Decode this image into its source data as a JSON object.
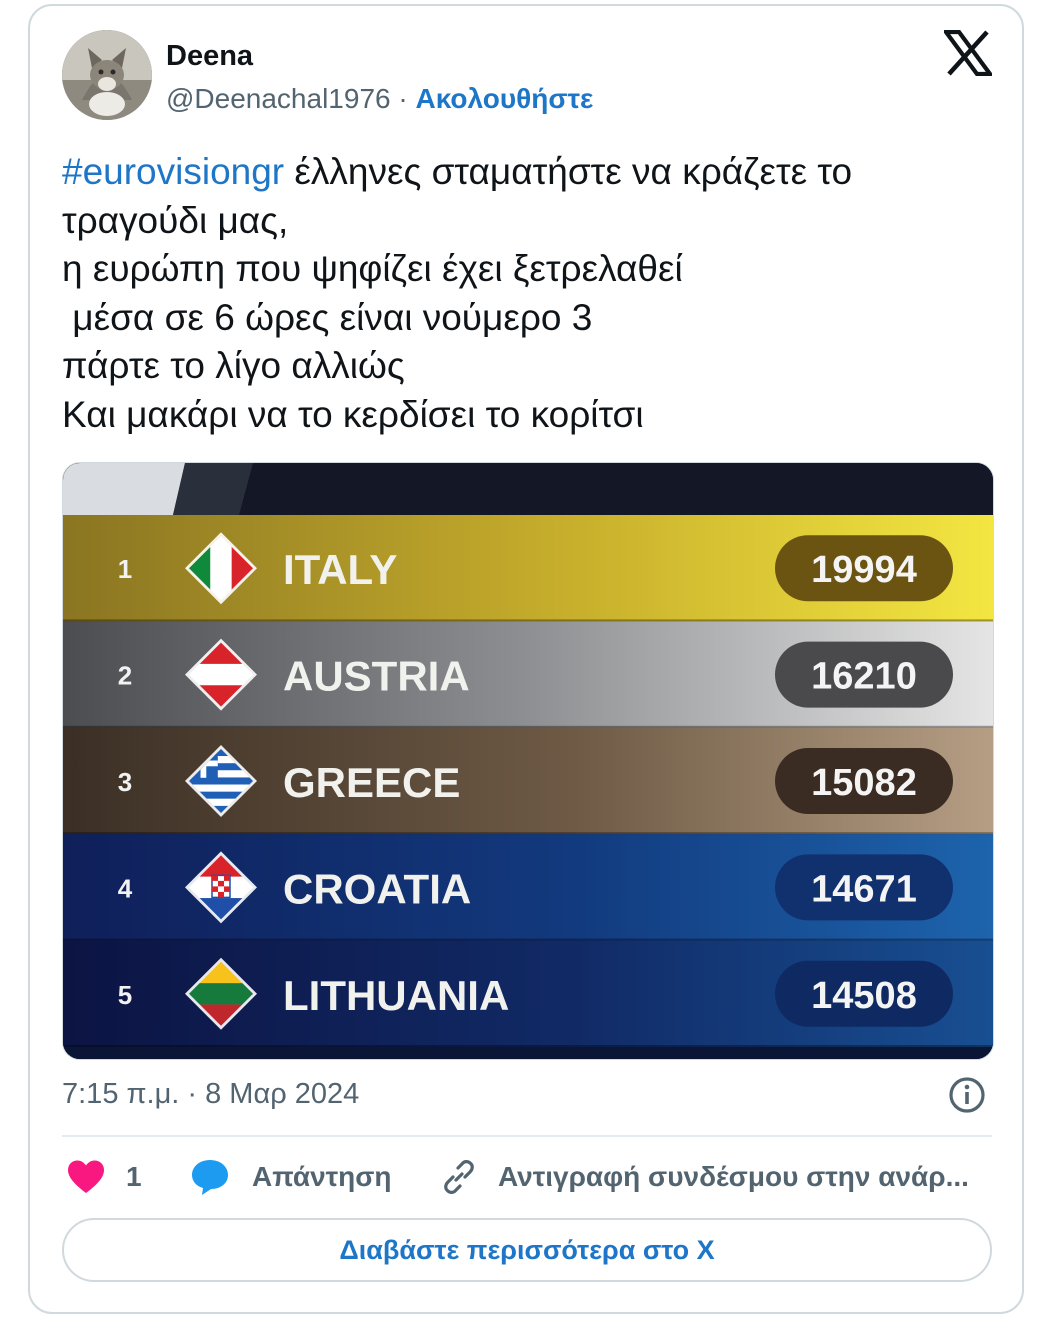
{
  "tweet": {
    "author_name": "Deena",
    "handle": "@Deenachal1976",
    "separator": "·",
    "follow_label": "Ακολουθήστε",
    "hashtag": "#eurovisiongr",
    "text_first_line_rest": " έλληνες σταματήστε να κράζετε το",
    "text_rest": "τραγούδι μας,\nη ευρώπη που ψηφίζει έχει ξετρελαθεί\n μέσα σε 6 ώρες είναι νούμερο 3\nπάρτε το λίγο αλλιώς\nΚαι μακάρι να το κερδίσει το κορίτσι",
    "timestamp": "7:15 π.μ. · 8 Μαρ 2024"
  },
  "ranking": {
    "rows": [
      {
        "rank": "1",
        "country": "ITALY",
        "score": "19994",
        "flag_icon": "italy-flag-icon"
      },
      {
        "rank": "2",
        "country": "AUSTRIA",
        "score": "16210",
        "flag_icon": "austria-flag-icon"
      },
      {
        "rank": "3",
        "country": "GREECE",
        "score": "15082",
        "flag_icon": "greece-flag-icon"
      },
      {
        "rank": "4",
        "country": "CROATIA",
        "score": "14671",
        "flag_icon": "croatia-flag-icon"
      },
      {
        "rank": "5",
        "country": "LITHUANIA",
        "score": "14508",
        "flag_icon": "lithuania-flag-icon"
      }
    ]
  },
  "actions": {
    "like_count": "1",
    "reply_label": "Απάντηση",
    "copy_link_label": "Αντιγραφή συνδέσμου στην ανάρ..."
  },
  "read_more_label": "Διαβάστε περισσότερα στο X",
  "colors": {
    "link": "#1d76c7",
    "muted": "#536471",
    "heart": "#f91880",
    "reply_bubble": "#1d9bf0",
    "border": "#cfd9de"
  }
}
